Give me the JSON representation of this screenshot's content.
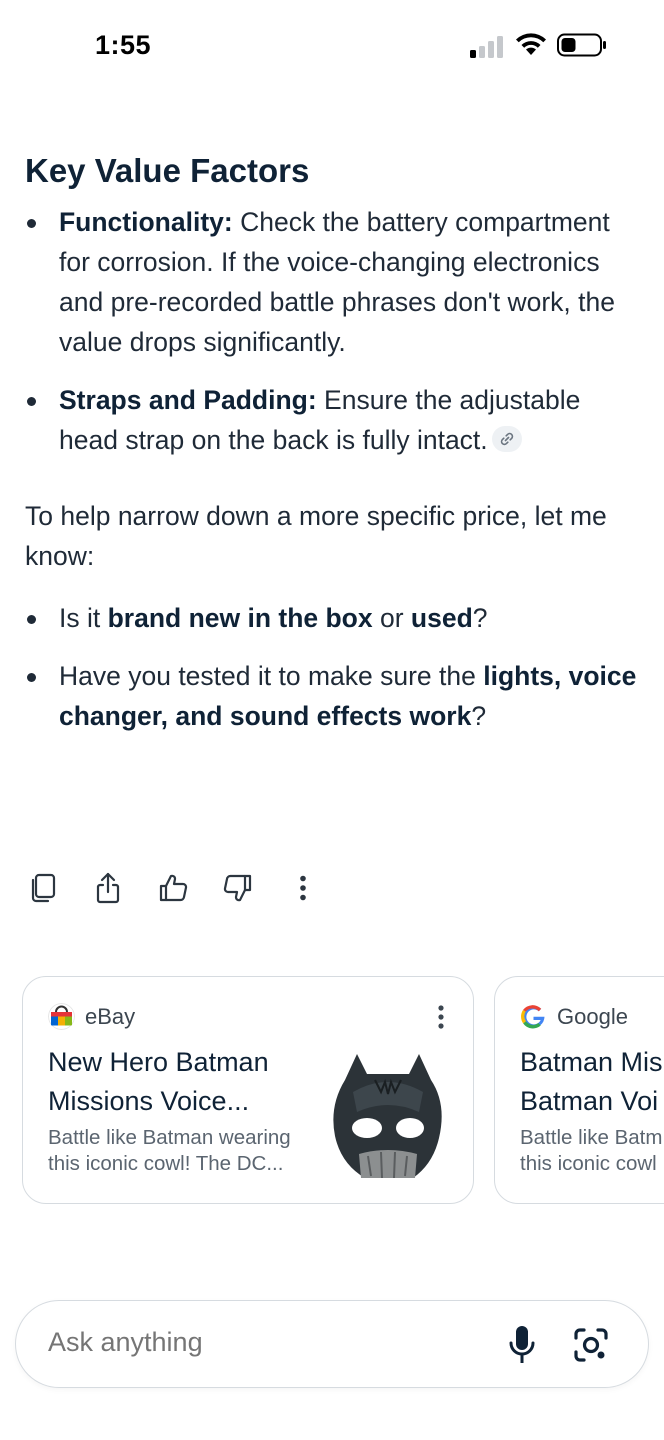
{
  "status_bar": {
    "time": "1:55",
    "icons": [
      "cellular-signal-icon",
      "wifi-icon",
      "battery-icon"
    ]
  },
  "response": {
    "heading": "Key Value Factors",
    "factors": [
      {
        "label": "Functionality:",
        "text": " Check the battery compartment for corrosion. If the voice-changing electronics and pre-recorded battle phrases don't work, the value drops significantly."
      },
      {
        "label": "Straps and Padding:",
        "text": " Ensure the adjustable head strap on the back is fully intact.",
        "has_link_chip": true
      }
    ],
    "followup_intro": "To help narrow down a more specific price, let me know:",
    "questions": [
      {
        "parts": [
          "Is it ",
          "brand new in the box",
          " or ",
          "used",
          "?"
        ]
      },
      {
        "parts": [
          "Have you tested it to make sure the ",
          "lights, voice changer, and sound effects work",
          "?"
        ]
      }
    ]
  },
  "actions": [
    "copy-icon",
    "share-icon",
    "thumbs-up-icon",
    "thumbs-down-icon",
    "more-vert-icon"
  ],
  "sources": [
    {
      "site": "eBay",
      "title": "New Hero Batman Missions Voice...",
      "description": "Battle like Batman wearing this iconic cowl! The DC..."
    },
    {
      "site": "Google",
      "title": "Batman Missions Batman Voice...",
      "title_visible_line1": "Batman Mis",
      "title_visible_line2": "Batman Voi",
      "description_visible_line1": "Battle like Batm",
      "description_visible_line2": "this iconic cowl"
    }
  ],
  "input": {
    "placeholder": "Ask anything"
  },
  "colors": {
    "text": "#1f2a37",
    "heading": "#0f2236",
    "muted": "#5b6570",
    "border": "#d6dbe0"
  }
}
